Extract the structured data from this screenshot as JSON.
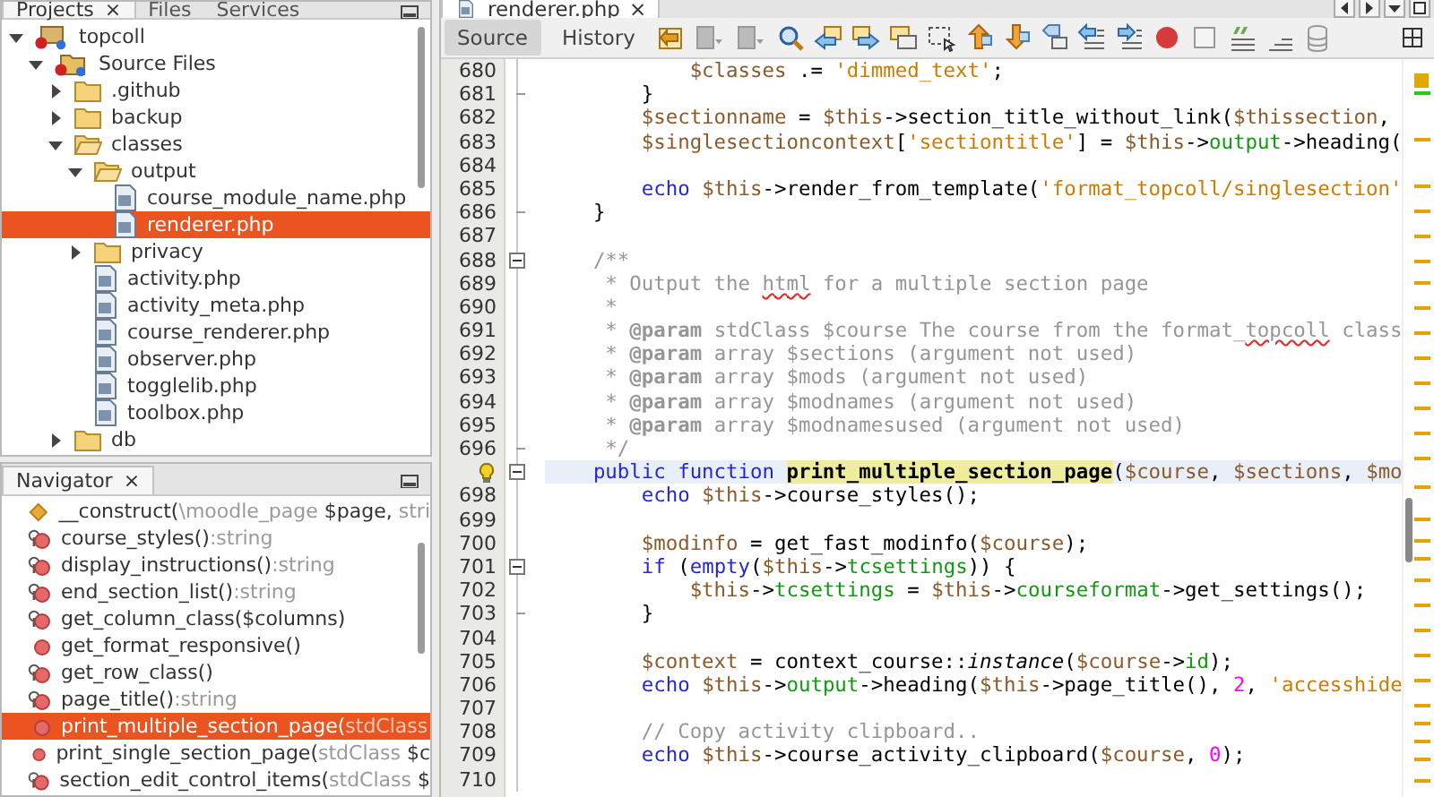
{
  "projects_panel": {
    "tabs": [
      {
        "label": "Projects",
        "close": "×",
        "selected": true
      },
      {
        "label": "Files",
        "selected": false
      },
      {
        "label": "Services",
        "selected": false
      }
    ],
    "tree": [
      {
        "label": "topcoll",
        "kind": "project",
        "expanded": true,
        "children": [
          {
            "label": "Source Files",
            "kind": "source-root",
            "expanded": true,
            "children": [
              {
                "label": ".github",
                "kind": "folder",
                "expanded": false
              },
              {
                "label": "backup",
                "kind": "folder",
                "expanded": false
              },
              {
                "label": "classes",
                "kind": "folder",
                "expanded": true,
                "children": [
                  {
                    "label": "output",
                    "kind": "folder",
                    "expanded": true,
                    "children": [
                      {
                        "label": "course_module_name.php",
                        "kind": "file",
                        "selected": false
                      },
                      {
                        "label": "renderer.php",
                        "kind": "file",
                        "selected": true
                      }
                    ]
                  },
                  {
                    "label": "privacy",
                    "kind": "folder",
                    "expanded": false
                  },
                  {
                    "label": "activity.php",
                    "kind": "file",
                    "selected": false
                  },
                  {
                    "label": "activity_meta.php",
                    "kind": "file",
                    "selected": false
                  },
                  {
                    "label": "course_renderer.php",
                    "kind": "file",
                    "selected": false
                  },
                  {
                    "label": "observer.php",
                    "kind": "file",
                    "selected": false
                  },
                  {
                    "label": "togglelib.php",
                    "kind": "file",
                    "selected": false
                  },
                  {
                    "label": "toolbox.php",
                    "kind": "file",
                    "selected": false
                  }
                ]
              },
              {
                "label": "db",
                "kind": "folder",
                "expanded": false
              }
            ]
          }
        ]
      }
    ]
  },
  "navigator": {
    "tab": {
      "label": "Navigator",
      "close": "×"
    },
    "items": [
      {
        "kind": "constructor",
        "selected": false,
        "parts": [
          {
            "text": "__construct(",
            "muted": false
          },
          {
            "text": "\\moodle_page",
            "muted": true
          },
          {
            "text": " $page, ",
            "muted": false
          },
          {
            "text": "stri",
            "muted": true
          }
        ]
      },
      {
        "kind": "override",
        "selected": false,
        "parts": [
          {
            "text": "course_styles()",
            "muted": false
          },
          {
            "text": ":string",
            "muted": true
          }
        ]
      },
      {
        "kind": "override",
        "selected": false,
        "parts": [
          {
            "text": "display_instructions()",
            "muted": false
          },
          {
            "text": ":string",
            "muted": true
          }
        ]
      },
      {
        "kind": "override",
        "selected": false,
        "parts": [
          {
            "text": "end_section_list()",
            "muted": false
          },
          {
            "text": ":string",
            "muted": true
          }
        ]
      },
      {
        "kind": "override",
        "selected": false,
        "parts": [
          {
            "text": "get_column_class($columns)",
            "muted": false
          }
        ]
      },
      {
        "kind": "method",
        "selected": false,
        "parts": [
          {
            "text": "get_format_responsive()",
            "muted": false
          }
        ]
      },
      {
        "kind": "override",
        "selected": false,
        "parts": [
          {
            "text": "get_row_class()",
            "muted": false
          }
        ]
      },
      {
        "kind": "override",
        "selected": false,
        "parts": [
          {
            "text": "page_title()",
            "muted": false
          },
          {
            "text": ":string",
            "muted": true
          }
        ]
      },
      {
        "kind": "method",
        "selected": true,
        "parts": [
          {
            "text": "print_multiple_section_page(",
            "muted": false
          },
          {
            "text": "stdClass",
            "muted": true
          }
        ]
      },
      {
        "kind": "method",
        "selected": false,
        "parts": [
          {
            "text": "print_single_section_page(",
            "muted": false
          },
          {
            "text": "stdClass",
            "muted": true
          },
          {
            "text": " $c",
            "muted": false
          }
        ]
      },
      {
        "kind": "override",
        "selected": false,
        "parts": [
          {
            "text": "section_edit_control_items(",
            "muted": false
          },
          {
            "text": "stdClass",
            "muted": true
          },
          {
            "text": " $",
            "muted": false
          }
        ]
      }
    ]
  },
  "editor": {
    "tabs": [
      {
        "label": "renderer.php",
        "close": "×",
        "selected": true
      }
    ],
    "views": [
      {
        "label": "Source",
        "selected": true
      },
      {
        "label": "History",
        "selected": false
      }
    ],
    "lines": [
      {
        "number": "680",
        "tokens": [
          {
            "kind": "variable",
            "text": "            $classes"
          },
          {
            "kind": "plain",
            "text": " .= "
          },
          {
            "kind": "string",
            "text": "'dimmed_text'"
          },
          {
            "kind": "plain",
            "text": ";"
          }
        ]
      },
      {
        "number": "681",
        "fold": {
          "kind": "end"
        },
        "tokens": [
          {
            "kind": "plain",
            "text": "        }"
          }
        ]
      },
      {
        "number": "682",
        "tokens": [
          {
            "kind": "variable",
            "text": "        $sectionname"
          },
          {
            "kind": "plain",
            "text": " = "
          },
          {
            "kind": "variable",
            "text": "$this"
          },
          {
            "kind": "plain",
            "text": "->section_title_without_link("
          },
          {
            "kind": "variable",
            "text": "$thissection"
          },
          {
            "kind": "plain",
            "text": ","
          }
        ]
      },
      {
        "number": "683",
        "tokens": [
          {
            "kind": "variable",
            "text": "        $singlesectioncontext"
          },
          {
            "kind": "plain",
            "text": "["
          },
          {
            "kind": "string",
            "text": "'sectiontitle'"
          },
          {
            "kind": "plain",
            "text": "] = "
          },
          {
            "kind": "variable",
            "text": "$this"
          },
          {
            "kind": "plain",
            "text": "->"
          },
          {
            "kind": "property",
            "text": "output"
          },
          {
            "kind": "plain",
            "text": "->heading("
          }
        ]
      },
      {
        "number": "684"
      },
      {
        "number": "685",
        "tokens": [
          {
            "kind": "keyword",
            "text": "        echo "
          },
          {
            "kind": "variable",
            "text": "$this"
          },
          {
            "kind": "plain",
            "text": "->render_from_template("
          },
          {
            "kind": "string",
            "text": "'format_topcoll/singlesection'"
          }
        ]
      },
      {
        "number": "686",
        "fold": {
          "kind": "end"
        },
        "tokens": [
          {
            "kind": "plain",
            "text": "    }"
          }
        ]
      },
      {
        "number": "687"
      },
      {
        "number": "688",
        "fold": {
          "kind": "open"
        },
        "tokens": [
          {
            "kind": "comment",
            "text": "    /**"
          }
        ]
      },
      {
        "number": "689",
        "tokens": [
          {
            "kind": "comment",
            "text": "     * Output the "
          },
          {
            "kind": "misspelled",
            "text": "html"
          },
          {
            "kind": "comment",
            "text": " for a multiple section page"
          }
        ]
      },
      {
        "number": "690",
        "tokens": [
          {
            "kind": "comment",
            "text": "     *"
          }
        ]
      },
      {
        "number": "691",
        "tokens": [
          {
            "kind": "comment",
            "text": "     * "
          },
          {
            "kind": "doctag",
            "text": "@param"
          },
          {
            "kind": "comment",
            "text": " stdClass $course The course from the format_"
          },
          {
            "kind": "misspelled",
            "text": "topcoll"
          },
          {
            "kind": "comment",
            "text": " class"
          }
        ]
      },
      {
        "number": "692",
        "tokens": [
          {
            "kind": "comment",
            "text": "     * "
          },
          {
            "kind": "doctag",
            "text": "@param"
          },
          {
            "kind": "comment",
            "text": " array $sections (argument not used)"
          }
        ]
      },
      {
        "number": "693",
        "tokens": [
          {
            "kind": "comment",
            "text": "     * "
          },
          {
            "kind": "doctag",
            "text": "@param"
          },
          {
            "kind": "comment",
            "text": " array $mods (argument not used)"
          }
        ]
      },
      {
        "number": "694",
        "tokens": [
          {
            "kind": "comment",
            "text": "     * "
          },
          {
            "kind": "doctag",
            "text": "@param"
          },
          {
            "kind": "comment",
            "text": " array $modnames (argument not used)"
          }
        ]
      },
      {
        "number": "695",
        "tokens": [
          {
            "kind": "comment",
            "text": "     * "
          },
          {
            "kind": "doctag",
            "text": "@param"
          },
          {
            "kind": "comment",
            "text": " array $modnamesused (argument not used)"
          }
        ]
      },
      {
        "number": "696",
        "fold": {
          "kind": "end"
        },
        "tokens": [
          {
            "kind": "comment",
            "text": "     */"
          }
        ]
      },
      {
        "hint": true,
        "fold": {
          "kind": "open"
        },
        "highlighted": true,
        "tokens": [
          {
            "kind": "keyword",
            "text": "    public function "
          },
          {
            "kind": "declaration",
            "text": "print_multiple_section_page"
          },
          {
            "kind": "plain",
            "text": "("
          },
          {
            "kind": "variable",
            "text": "$course"
          },
          {
            "kind": "plain",
            "text": ", "
          },
          {
            "kind": "variable",
            "text": "$sections"
          },
          {
            "kind": "plain",
            "text": ", "
          },
          {
            "kind": "variable",
            "text": "$mo"
          }
        ]
      },
      {
        "number": "698",
        "tokens": [
          {
            "kind": "keyword",
            "text": "        echo "
          },
          {
            "kind": "variable",
            "text": "$this"
          },
          {
            "kind": "plain",
            "text": "->course_styles();"
          }
        ]
      },
      {
        "number": "699"
      },
      {
        "number": "700",
        "tokens": [
          {
            "kind": "variable",
            "text": "        $modinfo"
          },
          {
            "kind": "plain",
            "text": " = get_fast_modinfo("
          },
          {
            "kind": "variable",
            "text": "$course"
          },
          {
            "kind": "plain",
            "text": ");"
          }
        ]
      },
      {
        "number": "701",
        "fold": {
          "kind": "open"
        },
        "tokens": [
          {
            "kind": "keyword",
            "text": "        if"
          },
          {
            "kind": "plain",
            "text": " ("
          },
          {
            "kind": "keyword",
            "text": "empty"
          },
          {
            "kind": "plain",
            "text": "("
          },
          {
            "kind": "variable",
            "text": "$this"
          },
          {
            "kind": "plain",
            "text": "->"
          },
          {
            "kind": "property",
            "text": "tcsettings"
          },
          {
            "kind": "plain",
            "text": ")) {"
          }
        ]
      },
      {
        "number": "702",
        "tokens": [
          {
            "kind": "variable",
            "text": "            $this"
          },
          {
            "kind": "plain",
            "text": "->"
          },
          {
            "kind": "property",
            "text": "tcsettings"
          },
          {
            "kind": "plain",
            "text": " = "
          },
          {
            "kind": "variable",
            "text": "$this"
          },
          {
            "kind": "plain",
            "text": "->"
          },
          {
            "kind": "property",
            "text": "courseformat"
          },
          {
            "kind": "plain",
            "text": "->get_settings();"
          }
        ]
      },
      {
        "number": "703",
        "fold": {
          "kind": "end"
        },
        "tokens": [
          {
            "kind": "plain",
            "text": "        }"
          }
        ]
      },
      {
        "number": "704"
      },
      {
        "number": "705",
        "tokens": [
          {
            "kind": "variable",
            "text": "        $context"
          },
          {
            "kind": "plain",
            "text": " = context_course::"
          },
          {
            "kind": "static",
            "text": "instance"
          },
          {
            "kind": "plain",
            "text": "("
          },
          {
            "kind": "variable",
            "text": "$course"
          },
          {
            "kind": "plain",
            "text": "->"
          },
          {
            "kind": "property",
            "text": "id"
          },
          {
            "kind": "plain",
            "text": ");"
          }
        ]
      },
      {
        "number": "706",
        "tokens": [
          {
            "kind": "keyword",
            "text": "        echo "
          },
          {
            "kind": "variable",
            "text": "$this"
          },
          {
            "kind": "plain",
            "text": "->"
          },
          {
            "kind": "property",
            "text": "output"
          },
          {
            "kind": "plain",
            "text": "->heading("
          },
          {
            "kind": "variable",
            "text": "$this"
          },
          {
            "kind": "plain",
            "text": "->page_title(), "
          },
          {
            "kind": "number",
            "text": "2"
          },
          {
            "kind": "plain",
            "text": ", "
          },
          {
            "kind": "string",
            "text": "'accesshide"
          }
        ]
      },
      {
        "number": "707"
      },
      {
        "number": "708",
        "tokens": [
          {
            "kind": "comment",
            "text": "        // Copy activity clipboard.."
          }
        ]
      },
      {
        "number": "709",
        "tokens": [
          {
            "kind": "keyword",
            "text": "        echo "
          },
          {
            "kind": "variable",
            "text": "$this"
          },
          {
            "kind": "plain",
            "text": "->course_activity_clipboard("
          },
          {
            "kind": "variable",
            "text": "$course"
          },
          {
            "kind": "plain",
            "text": ", "
          },
          {
            "kind": "number",
            "text": "0"
          },
          {
            "kind": "plain",
            "text": ");"
          }
        ]
      },
      {
        "number": "710"
      }
    ]
  }
}
